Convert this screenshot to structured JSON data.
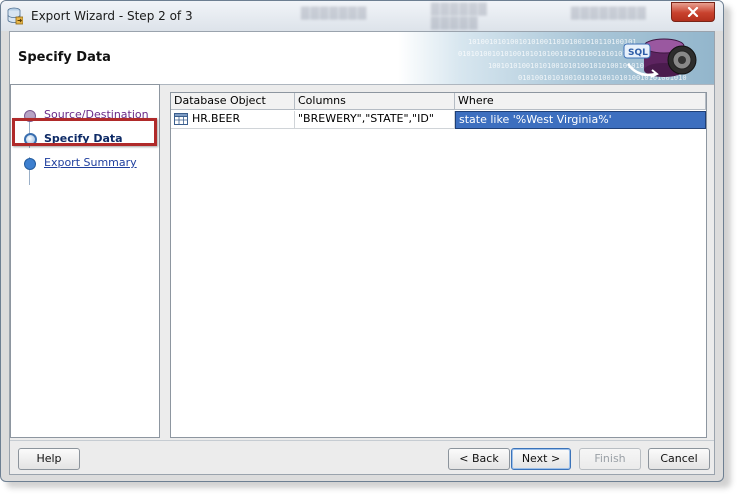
{
  "window": {
    "title": "Export Wizard - Step 2 of 3",
    "app_icon": "database-export-icon",
    "close_icon": "close-icon"
  },
  "header": {
    "title": "Specify Data",
    "banner_icon": "sql-database-icon",
    "banner_icon_text": "SQL"
  },
  "steps": [
    {
      "label": "Source/Destination",
      "state": "visited"
    },
    {
      "label": "Specify Data",
      "state": "current"
    },
    {
      "label": "Export Summary",
      "state": "pending"
    }
  ],
  "grid": {
    "columns": [
      "Database Object",
      "Columns",
      "Where"
    ],
    "rows": [
      {
        "object": "HR.BEER",
        "object_icon": "table-icon",
        "columns": "\"BREWERY\",\"STATE\",\"ID\"",
        "where": "state like '%West Virginia%'"
      }
    ]
  },
  "buttons": {
    "help": "Help",
    "back": "< Back",
    "next": "Next >",
    "finish": "Finish",
    "cancel": "Cancel"
  },
  "colors": {
    "selection": "#3d6fbf",
    "highlight_border": "#b02a2a",
    "visited_link": "#6a2c8a",
    "link": "#1f3f9e"
  }
}
